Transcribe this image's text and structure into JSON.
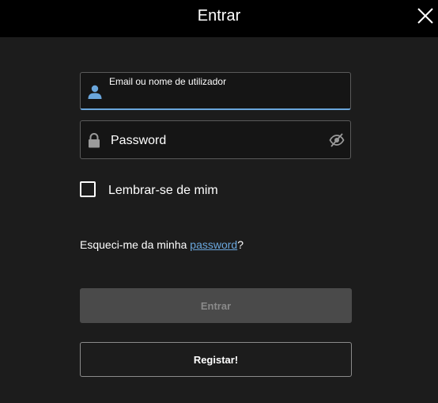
{
  "header": {
    "title": "Entrar",
    "close_icon": "close-icon"
  },
  "form": {
    "email": {
      "label": "Email ou nome de utilizador",
      "value": "",
      "icon": "user-icon"
    },
    "password": {
      "placeholder": "Password",
      "value": "",
      "icon": "lock-icon",
      "toggle_icon": "eye-slash-icon"
    },
    "remember": {
      "label": "Lembrar-se de mim",
      "checked": false
    },
    "forgot": {
      "prefix": "Esqueci-me da minha ",
      "link": "password",
      "suffix": "?"
    },
    "login_button": "Entrar",
    "register_button": "Registar!"
  },
  "colors": {
    "background": "#1c1c1c",
    "header": "#000000",
    "accent": "#6aa6dc",
    "disabled_button": "#4a4a4a"
  }
}
